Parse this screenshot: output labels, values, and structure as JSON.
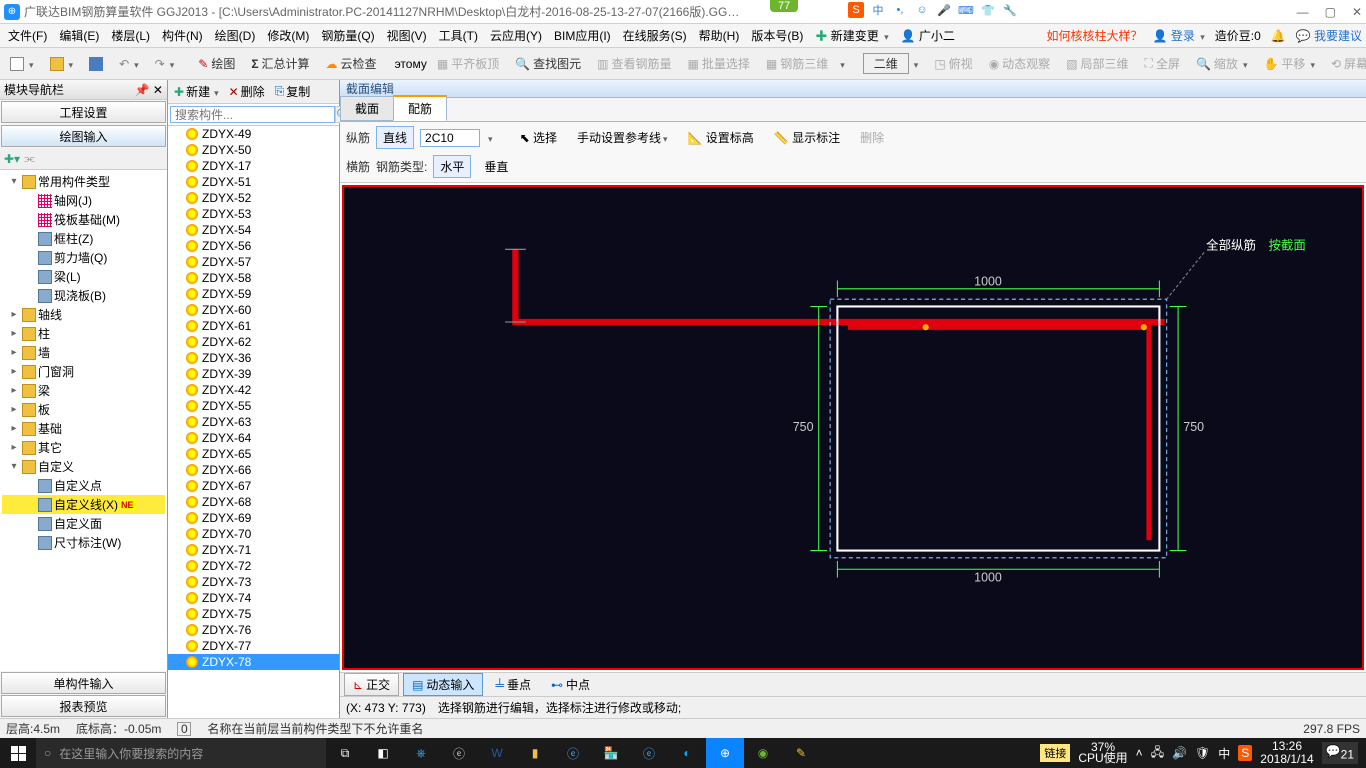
{
  "titlebar": {
    "app": "广联达BIM钢筋算量软件 GGJ2013 - [C:\\Users\\Administrator.PC-20141127NRHM\\Desktop\\白龙村-2016-08-25-13-27-07(2166版).GG…",
    "badge": "77",
    "ime": "中"
  },
  "menu": {
    "items": [
      "文件(F)",
      "编辑(E)",
      "楼层(L)",
      "构件(N)",
      "绘图(D)",
      "修改(M)",
      "钢筋量(Q)",
      "视图(V)",
      "工具(T)",
      "云应用(Y)",
      "BIM应用(I)",
      "在线服务(S)",
      "帮助(H)",
      "版本号(B)"
    ],
    "new_change": "新建变更",
    "guangxiaoer": "广小二",
    "promo": "如何核核柱大样？",
    "login": "登录",
    "price": "造价豆:0",
    "feedback": "我要建议"
  },
  "toolbar": {
    "draw": "绘图",
    "sumcalc": "汇总计算",
    "cloudcheck": "云检查",
    "flatslab": "平齐板顶",
    "findimg": "查找图元",
    "viewrebar": "查看钢筋量",
    "batchsel": "批量选择",
    "rebar3d": "钢筋三维",
    "twod": "二维",
    "overlook": "俯视",
    "dynview": "动态观察",
    "local3d": "局部三维",
    "fullscreen": "全屏",
    "zoom": "缩放",
    "pan": "平移",
    "screenrot": "屏幕旋转"
  },
  "nav": {
    "title": "模块导航栏",
    "tab_project": "工程设置",
    "tab_draw": "绘图输入",
    "tree": [
      {
        "indent": 0,
        "exp": "▾",
        "icon": "folder",
        "label": "常用构件类型"
      },
      {
        "indent": 1,
        "exp": "",
        "icon": "grid",
        "label": "轴网(J)"
      },
      {
        "indent": 1,
        "exp": "",
        "icon": "grid",
        "label": "筏板基础(M)"
      },
      {
        "indent": 1,
        "exp": "",
        "icon": "col",
        "label": "框柱(Z)"
      },
      {
        "indent": 1,
        "exp": "",
        "icon": "wall",
        "label": "剪力墙(Q)"
      },
      {
        "indent": 1,
        "exp": "",
        "icon": "beam",
        "label": "梁(L)"
      },
      {
        "indent": 1,
        "exp": "",
        "icon": "slab",
        "label": "现浇板(B)"
      },
      {
        "indent": 0,
        "exp": "▸",
        "icon": "folder",
        "label": "轴线"
      },
      {
        "indent": 0,
        "exp": "▸",
        "icon": "folder",
        "label": "柱"
      },
      {
        "indent": 0,
        "exp": "▸",
        "icon": "folder",
        "label": "墙"
      },
      {
        "indent": 0,
        "exp": "▸",
        "icon": "folder",
        "label": "门窗洞"
      },
      {
        "indent": 0,
        "exp": "▸",
        "icon": "folder",
        "label": "梁"
      },
      {
        "indent": 0,
        "exp": "▸",
        "icon": "folder",
        "label": "板"
      },
      {
        "indent": 0,
        "exp": "▸",
        "icon": "folder",
        "label": "基础"
      },
      {
        "indent": 0,
        "exp": "▸",
        "icon": "folder",
        "label": "其它"
      },
      {
        "indent": 0,
        "exp": "▾",
        "icon": "folder",
        "label": "自定义"
      },
      {
        "indent": 1,
        "exp": "",
        "icon": "pt",
        "label": "自定义点"
      },
      {
        "indent": 1,
        "exp": "",
        "icon": "ln",
        "label": "自定义线(X)",
        "hl": true,
        "badge": "NE"
      },
      {
        "indent": 1,
        "exp": "",
        "icon": "fc",
        "label": "自定义面"
      },
      {
        "indent": 1,
        "exp": "",
        "icon": "dm",
        "label": "尺寸标注(W)"
      }
    ],
    "bottom": [
      "单构件输入",
      "报表预览"
    ]
  },
  "complist": {
    "new": "新建",
    "delete": "删除",
    "copy": "复制",
    "search_ph": "搜索构件...",
    "items": [
      "ZDYX-49",
      "ZDYX-50",
      "ZDYX-17",
      "ZDYX-51",
      "ZDYX-52",
      "ZDYX-53",
      "ZDYX-54",
      "ZDYX-56",
      "ZDYX-57",
      "ZDYX-58",
      "ZDYX-59",
      "ZDYX-60",
      "ZDYX-61",
      "ZDYX-62",
      "ZDYX-36",
      "ZDYX-39",
      "ZDYX-42",
      "ZDYX-55",
      "ZDYX-63",
      "ZDYX-64",
      "ZDYX-65",
      "ZDYX-66",
      "ZDYX-67",
      "ZDYX-68",
      "ZDYX-69",
      "ZDYX-70",
      "ZDYX-71",
      "ZDYX-72",
      "ZDYX-73",
      "ZDYX-74",
      "ZDYX-75",
      "ZDYX-76",
      "ZDYX-77",
      "ZDYX-78"
    ],
    "selected": "ZDYX-78"
  },
  "editor": {
    "title": "截面编辑",
    "tab_section": "截面",
    "tab_rebar": "配筋",
    "row1": {
      "label_long": "纵筋",
      "line": "直线",
      "spec": "2C10",
      "select": "选择",
      "manual_ref": "手动设置参考线",
      "set_elev": "设置标高",
      "show_dim": "显示标注",
      "delete": "删除"
    },
    "row2": {
      "label_trans": "横筋",
      "rebar_type": "钢筋类型:",
      "horiz": "水平",
      "vert": "垂直"
    },
    "canvas": {
      "all_long": "全部纵筋",
      "by_section": "按截面",
      "dim1000a": "1000",
      "dim1000b": "1000",
      "dim750a": "750",
      "dim750b": "750"
    },
    "bottom": {
      "ortho": "正交",
      "dyninput": "动态输入",
      "perp": "垂点",
      "mid": "中点"
    },
    "status": {
      "coord": "(X: 473 Y: 773)",
      "hint": "选择钢筋进行编辑，选择标注进行修改或移动;"
    }
  },
  "statusbar": {
    "floor_h": "层高:4.5m",
    "bot_elev": "底标高：-0.05m",
    "zero": "0",
    "msg": "名称在当前层当前构件类型下不允许重名",
    "fps": "297.8 FPS"
  },
  "taskbar": {
    "search_ph": "在这里输入你要搜索的内容",
    "link": "链接",
    "cpu_pct": "37%",
    "cpu_lbl": "CPU使用",
    "ime": "中",
    "time": "13:26",
    "date": "2018/1/14",
    "notif": "21"
  }
}
